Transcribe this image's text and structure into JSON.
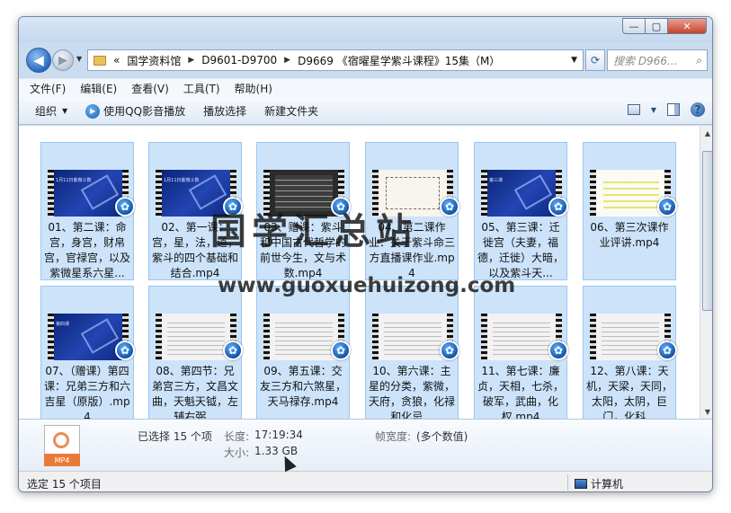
{
  "titlebar": {
    "minimize": "—",
    "maximize": "▢",
    "close": "✕"
  },
  "nav": {
    "back_icon": "◀",
    "forward_icon": "▶",
    "breadcrumb_overflow": "«",
    "breadcrumbs": [
      "国学资料馆",
      "D9601-D9700",
      "D9669 《宿曜星学紫斗课程》15集（M）"
    ],
    "search_placeholder": "搜索 D966..."
  },
  "menu": [
    "文件(F)",
    "编辑(E)",
    "查看(V)",
    "工具(T)",
    "帮助(H)"
  ],
  "toolbar": {
    "organize": "组织",
    "play_qq": "使用QQ影音播放",
    "play_selection": "播放选择",
    "new_folder": "新建文件夹",
    "help_icon": "?"
  },
  "files": [
    {
      "name": "01、第二课：命宫，身宫，财帛宫，官禄宫，以及紫微星系六星...",
      "thumb": "blue",
      "banner": "1月11日紫微斗数"
    },
    {
      "name": "02、第一课：宫，星，法，道，紫斗的四个基础和结合.mp4",
      "thumb": "blue",
      "banner": "1月11日紫微斗数"
    },
    {
      "name": "03、赠课：紫斗和中国古代哲学的前世今生，文与术数.mp4",
      "thumb": "dark",
      "banner": ""
    },
    {
      "name": "04、第二课作业：关于紫斗命三方直播课作业.mp4",
      "thumb": "sketch",
      "banner": ""
    },
    {
      "name": "05、第三课：迁徙宫（夫妻，福德，迁徙）大暗，以及紫斗天...",
      "thumb": "blue",
      "banner": "第三课"
    },
    {
      "name": "06、第三次课作业评讲.mp4",
      "thumb": "yellow",
      "banner": ""
    },
    {
      "name": "07、（赠课）第四课：兄弟三方和六吉星（原版）.mp4",
      "thumb": "blue",
      "banner": "第四课"
    },
    {
      "name": "08、第四节：兄弟宫三方，文昌文曲，天魁天钺，左辅右弼...",
      "thumb": "doc",
      "banner": ""
    },
    {
      "name": "09、第五课：交友三方和六煞星，天马禄存.mp4",
      "thumb": "doc",
      "banner": ""
    },
    {
      "name": "10、第六课：主星的分类，紫微，天府，贪狼，化禄和化忌...",
      "thumb": "doc",
      "banner": ""
    },
    {
      "name": "11、第七课：廉贞，天相，七杀，破军，武曲，化权.mp4",
      "thumb": "doc",
      "banner": ""
    },
    {
      "name": "12、第八课：天机，天梁，天同，太阳，太阴，巨门，化科...",
      "thumb": "doc",
      "banner": ""
    }
  ],
  "details": {
    "file_icon_label": "MP4",
    "selected": "已选择 15 个项",
    "length_label": "长度:",
    "length_value": "17:19:34",
    "size_label": "大小:",
    "size_value": "1.33 GB",
    "width_label": "帧宽度:",
    "width_value": "(多个数值)"
  },
  "status": {
    "left": "选定 15 个项目",
    "right": "计算机"
  },
  "watermark": {
    "cn": "国学汇总站",
    "url": "www.guoxuehuizong.com"
  }
}
